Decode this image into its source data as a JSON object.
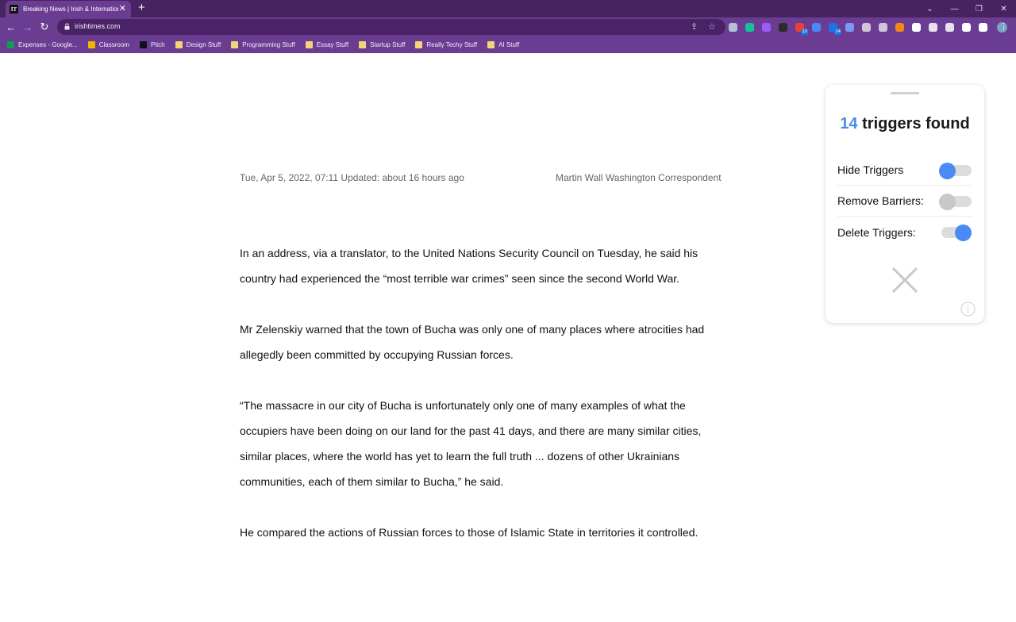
{
  "browser": {
    "tab": {
      "favicon_text": "IT",
      "title": "Breaking News | Irish & International"
    },
    "url": "irishtimes.com",
    "extensions": [
      {
        "icon": "extension-icon",
        "color": "#b5c1d6"
      },
      {
        "icon": "grammarly-icon",
        "color": "#15c39a"
      },
      {
        "icon": "extension-icon",
        "color": "#9a5cf5"
      },
      {
        "icon": "font-icon",
        "color": "#2b2b2b"
      },
      {
        "icon": "extension-icon",
        "color": "#e94235",
        "badge": "10"
      },
      {
        "icon": "extension-icon",
        "color": "#4a8af4"
      },
      {
        "icon": "extension-icon",
        "color": "#1a73e8",
        "badge": "14"
      },
      {
        "icon": "extension-icon",
        "color": "#7b9bf0"
      },
      {
        "icon": "extension-icon",
        "color": "#cfc6da"
      },
      {
        "icon": "extension-icon",
        "color": "#cfc6da"
      },
      {
        "icon": "fox-icon",
        "color": "#f6851b"
      },
      {
        "icon": "notion-icon",
        "color": "#ffffff"
      },
      {
        "icon": "extension-icon",
        "color": "#e8e0f0"
      },
      {
        "icon": "extension-icon",
        "color": "#e8e0f0"
      },
      {
        "icon": "puzzle-icon",
        "color": "#ffffff"
      },
      {
        "icon": "sidebar-icon",
        "color": "#ffffff"
      }
    ],
    "bookmarks": [
      {
        "label": "Expenses - Google...",
        "icon": "sheets-icon",
        "color": "#0f9d58"
      },
      {
        "label": "Classroom",
        "icon": "classroom-icon",
        "color": "#f4b400"
      },
      {
        "label": "Pitch",
        "icon": "pitch-icon",
        "color": "#111111"
      },
      {
        "label": "Design Stuff",
        "icon": "folder-icon",
        "color": "#f2d675"
      },
      {
        "label": "Programming Stuff",
        "icon": "folder-icon",
        "color": "#f2d675"
      },
      {
        "label": "Essay Stuff",
        "icon": "folder-icon",
        "color": "#f2d675"
      },
      {
        "label": "Startup Stuff",
        "icon": "folder-icon",
        "color": "#f2d675"
      },
      {
        "label": "Really Techy Stuff",
        "icon": "folder-icon",
        "color": "#f2d675"
      },
      {
        "label": "AI Stuff",
        "icon": "folder-icon",
        "color": "#f2d675"
      }
    ]
  },
  "article": {
    "date": "Tue, Apr 5, 2022, 07:11 Updated: about 16 hours ago",
    "author": "Martin Wall Washington Correspondent",
    "paragraphs": [
      {
        "lines": [
          "In an address, via a translator, to the United Nations Security Council on Tuesday, he said his",
          "country had experienced the “most terrible war crimes” seen since the second World War."
        ]
      },
      {
        "lines": [
          "Mr Zelenskiy warned that the town of Bucha was only one of many places where atrocities had",
          "allegedly been committed by occupying Russian forces."
        ]
      },
      {
        "lines": [
          "“The massacre in our city of Bucha is unfortunately only one of many examples of what the",
          "occupiers have been doing on our land for the past 41 days, and there are many similar cities,",
          "similar places, where the world has yet to learn the full truth ... dozens of other Ukrainians",
          "communities, each of them similar to Bucha,” he said."
        ]
      },
      {
        "lines": [
          "He compared the actions of Russian forces to those of Islamic State in territories it controlled."
        ]
      }
    ]
  },
  "panel": {
    "count": "14",
    "title_suffix": " triggers found",
    "options": [
      {
        "label": "Hide Triggers",
        "enabled": true
      },
      {
        "label": "Remove Barriers:",
        "enabled": false
      },
      {
        "label": "Delete Triggers:",
        "enabled": true
      }
    ],
    "accent": "#4a8af4"
  }
}
